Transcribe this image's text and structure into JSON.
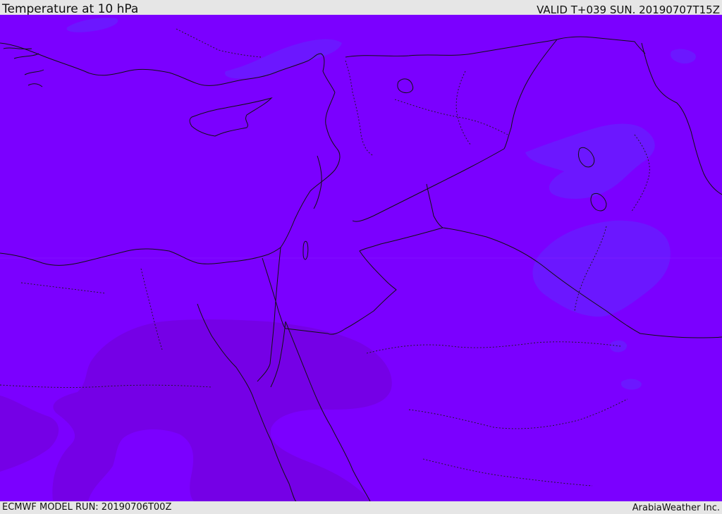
{
  "header": {
    "title": "Temperature at 10 hPa",
    "valid": "VALID T+039 SUN. 20190707T15Z"
  },
  "footer": {
    "model_run": "ECMWF MODEL RUN: 20190706T00Z",
    "credit": "ArabiaWeather Inc."
  },
  "map": {
    "colors": {
      "background": "#7b00ff",
      "cool_patch": "#6a1aff",
      "warm_patch": "#7700e0",
      "header_bg": "#e6e6e6"
    }
  }
}
